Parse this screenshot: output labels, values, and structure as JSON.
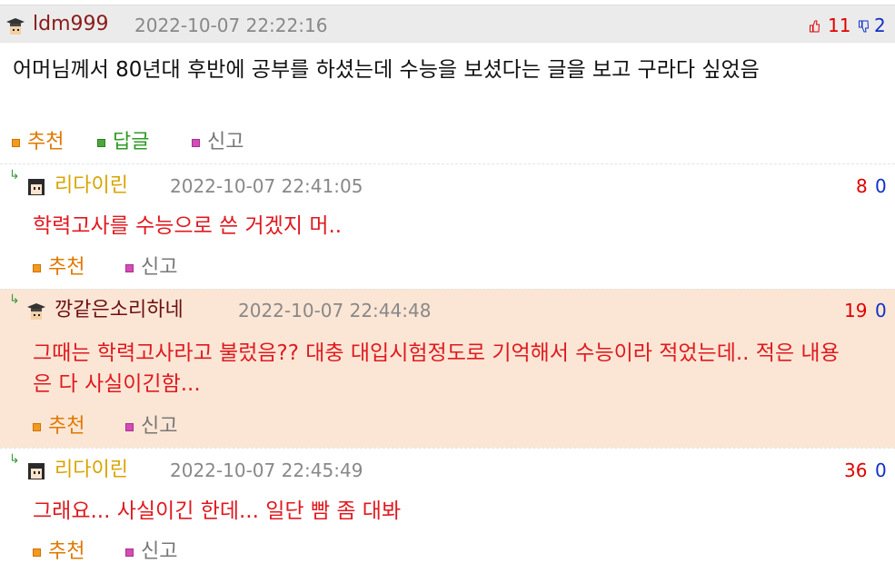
{
  "post": {
    "username": "ldm999",
    "timestamp": "2022-10-07 22:22:16",
    "upvotes": "11",
    "downvotes": "2",
    "body": "어머님께서 80년대 후반에 공부를 하셨는데 수능을 보셨다는 글을 보고 구라다 싶었음",
    "actions": {
      "recommend": "추천",
      "reply": "답글",
      "report": "신고"
    }
  },
  "replies": [
    {
      "arrow": "↳",
      "username": "리다이린",
      "timestamp": "2022-10-07 22:41:05",
      "upvotes": "8",
      "downvotes": "0",
      "body": "학력고사를 수능으로 쓴 거겠지 머..",
      "actions": {
        "recommend": "추천",
        "report": "신고"
      }
    },
    {
      "arrow": "↳",
      "username": "깡같은소리하네",
      "timestamp": "2022-10-07 22:44:48",
      "upvotes": "19",
      "downvotes": "0",
      "body": "그때는 학력고사라고 불렀음?? 대충 대입시험정도로 기억해서 수능이라 적었는데.. 적은 내용은 다 사실이긴함...",
      "actions": {
        "recommend": "추천",
        "report": "신고"
      }
    },
    {
      "arrow": "↳",
      "username": "리다이린",
      "timestamp": "2022-10-07 22:45:49",
      "upvotes": "36",
      "downvotes": "0",
      "body": "그래요... 사실이긴 한데... 일단 빰 좀 대봐",
      "actions": {
        "recommend": "추천",
        "report": "신고"
      }
    }
  ],
  "colors": {
    "header_bg": "#ebebeb",
    "highlight_bg": "#fbe6d5",
    "upvote": "#e00000",
    "downvote": "#1030c8",
    "reply_text": "#e0191f",
    "recommend": "#e07800",
    "reply_action": "#2e9b24",
    "report": "#777777"
  },
  "icons": {
    "avatar_main": "grad-cap-avatar-icon",
    "avatar_reply": "girl-avatar-icon",
    "thumb_up": "thumb-up-icon",
    "thumb_down": "thumb-down-icon",
    "reply_arrow": "reply-arrow-icon"
  }
}
